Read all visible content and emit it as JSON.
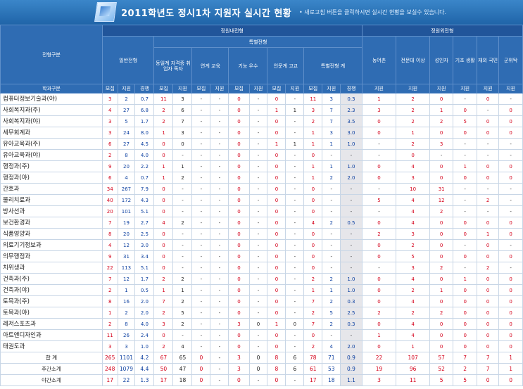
{
  "banner": {
    "title": "2011학년도 정시1차 지원자 실시간 현황",
    "note": "• 새로고침 버튼을 클릭하시면 실시간 현황을 보실수 있습니다."
  },
  "header": {
    "col_track": "전형구분",
    "group_in": "정원내전형",
    "group_out": "정원외전형",
    "general": "일반전형",
    "special": "특별전형",
    "sp1": "동일계 자격증 취업자 독자",
    "sp2": "연계 교육",
    "sp3": "기능 우수",
    "sp4": "인문계 고교",
    "sp_total": "특별전형 계",
    "o1": "농어촌",
    "o2": "전문대 이상",
    "o3": "성인자",
    "o4": "기초 생활",
    "o5": "재외 국민",
    "o6": "군위탁",
    "dept": "학과구분"
  },
  "sub_labels": [
    "모집",
    "지원",
    "경쟁",
    "모집",
    "지원",
    "모집",
    "지원",
    "모집",
    "지원",
    "모집",
    "지원",
    "모집",
    "지원",
    "경쟁",
    "지원",
    "지원",
    "지원",
    "지원",
    "지원",
    "지원"
  ],
  "rows": [
    [
      "컴퓨터정보기술과(야)",
      "3",
      "2",
      "0.7",
      "11",
      "3",
      "-",
      "-",
      "0",
      "-",
      "0",
      "-",
      "11",
      "3",
      "0.3",
      "1",
      "2",
      "0",
      "-",
      "0",
      "-"
    ],
    [
      "사회복지과(주)",
      "4",
      "27",
      "6.8",
      "2",
      "6",
      "-",
      "-",
      "0",
      "-",
      "1",
      "1",
      "3",
      "7",
      "2.3",
      "3",
      "2",
      "1",
      "0",
      "-",
      "0"
    ],
    [
      "사회복지과(야)",
      "3",
      "5",
      "1.7",
      "2",
      "7",
      "-",
      "-",
      "0",
      "-",
      "0",
      "-",
      "2",
      "7",
      "3.5",
      "0",
      "2",
      "2",
      "5",
      "0",
      "0"
    ],
    [
      "세무회계과",
      "3",
      "24",
      "8.0",
      "1",
      "3",
      "-",
      "-",
      "0",
      "-",
      "0",
      "-",
      "1",
      "3",
      "3.0",
      "0",
      "1",
      "0",
      "0",
      "0",
      "0"
    ],
    [
      "유아교육과(주)",
      "6",
      "27",
      "4.5",
      "0",
      "0",
      "-",
      "-",
      "0",
      "-",
      "1",
      "1",
      "1",
      "1",
      "1.0",
      "-",
      "2",
      "3",
      "-",
      "-",
      "-"
    ],
    [
      "유아교육과(야)",
      "2",
      "8",
      "4.0",
      "0",
      "-",
      "-",
      "-",
      "0",
      "-",
      "0",
      "-",
      "0",
      "-",
      "-",
      "-",
      "0",
      "-",
      "-",
      "-",
      "-"
    ],
    [
      "행정과(주)",
      "9",
      "20",
      "2.2",
      "1",
      "1",
      "-",
      "-",
      "0",
      "-",
      "0",
      "-",
      "1",
      "1",
      "1.0",
      "0",
      "4",
      "0",
      "1",
      "0",
      "0"
    ],
    [
      "행정과(야)",
      "6",
      "4",
      "0.7",
      "1",
      "2",
      "-",
      "-",
      "0",
      "-",
      "0",
      "-",
      "1",
      "2",
      "2.0",
      "0",
      "3",
      "0",
      "0",
      "0",
      "0"
    ],
    [
      "간호과",
      "34",
      "267",
      "7.9",
      "0",
      "-",
      "-",
      "-",
      "0",
      "-",
      "0",
      "-",
      "0",
      "-",
      "-",
      "-",
      "10",
      "31",
      "-",
      "-",
      "-"
    ],
    [
      "물리치료과",
      "40",
      "172",
      "4.3",
      "0",
      "-",
      "-",
      "-",
      "0",
      "-",
      "0",
      "-",
      "0",
      "-",
      "-",
      "5",
      "4",
      "12",
      "-",
      "2",
      "-"
    ],
    [
      "방사선과",
      "20",
      "101",
      "5.1",
      "0",
      "-",
      "-",
      "-",
      "0",
      "-",
      "0",
      "-",
      "0",
      "-",
      "-",
      "-",
      "4",
      "2",
      "-",
      "-",
      "-"
    ],
    [
      "보건환경과",
      "7",
      "19",
      "2.7",
      "4",
      "2",
      "-",
      "-",
      "0",
      "-",
      "0",
      "-",
      "4",
      "2",
      "0.5",
      "0",
      "4",
      "0",
      "0",
      "0",
      "0"
    ],
    [
      "식품영양과",
      "8",
      "20",
      "2.5",
      "0",
      "-",
      "-",
      "-",
      "0",
      "-",
      "0",
      "-",
      "0",
      "-",
      "-",
      "2",
      "3",
      "0",
      "0",
      "1",
      "0"
    ],
    [
      "의료기기정보과",
      "4",
      "12",
      "3.0",
      "0",
      "-",
      "-",
      "-",
      "0",
      "-",
      "0",
      "-",
      "0",
      "-",
      "-",
      "0",
      "2",
      "0",
      "-",
      "0",
      "-"
    ],
    [
      "의무행정과",
      "9",
      "31",
      "3.4",
      "0",
      "-",
      "-",
      "-",
      "0",
      "-",
      "0",
      "-",
      "0",
      "-",
      "-",
      "0",
      "5",
      "0",
      "0",
      "0",
      "0"
    ],
    [
      "치위생과",
      "22",
      "113",
      "5.1",
      "0",
      "-",
      "-",
      "-",
      "0",
      "-",
      "0",
      "-",
      "0",
      "-",
      "-",
      "-",
      "3",
      "2",
      "-",
      "2",
      "-"
    ],
    [
      "건축과(주)",
      "7",
      "12",
      "1.7",
      "2",
      "2",
      "-",
      "-",
      "0",
      "-",
      "0",
      "-",
      "2",
      "2",
      "1.0",
      "0",
      "4",
      "0",
      "1",
      "0",
      "0"
    ],
    [
      "건축과(야)",
      "2",
      "1",
      "0.5",
      "1",
      "1",
      "-",
      "-",
      "0",
      "-",
      "0",
      "-",
      "1",
      "1",
      "1.0",
      "0",
      "2",
      "1",
      "0",
      "0",
      "0"
    ],
    [
      "토목과(주)",
      "8",
      "16",
      "2.0",
      "7",
      "2",
      "-",
      "-",
      "0",
      "-",
      "0",
      "-",
      "7",
      "2",
      "0.3",
      "0",
      "4",
      "0",
      "0",
      "0",
      "0"
    ],
    [
      "토목과(야)",
      "1",
      "2",
      "2.0",
      "2",
      "5",
      "-",
      "-",
      "0",
      "-",
      "0",
      "-",
      "2",
      "5",
      "2.5",
      "2",
      "2",
      "2",
      "0",
      "0",
      "0"
    ],
    [
      "레저스포츠과",
      "2",
      "8",
      "4.0",
      "3",
      "2",
      "-",
      "-",
      "3",
      "0",
      "1",
      "0",
      "7",
      "2",
      "0.3",
      "0",
      "4",
      "0",
      "0",
      "0",
      "0"
    ],
    [
      "아트앤디자인과",
      "11",
      "26",
      "2.4",
      "0",
      "-",
      "-",
      "-",
      "0",
      "-",
      "0",
      "-",
      "0",
      "-",
      "-",
      "1",
      "4",
      "0",
      "0",
      "0",
      "0"
    ],
    [
      "태권도과",
      "3",
      "3",
      "1.0",
      "2",
      "4",
      "-",
      "-",
      "0",
      "-",
      "0",
      "-",
      "2",
      "4",
      "2.0",
      "0",
      "1",
      "0",
      "0",
      "0",
      "0"
    ]
  ],
  "totals": [
    [
      "합 계",
      "265",
      "1101",
      "4.2",
      "67",
      "65",
      "0",
      "-",
      "3",
      "0",
      "8",
      "6",
      "78",
      "71",
      "0.9",
      "22",
      "107",
      "57",
      "7",
      "7",
      "1"
    ],
    [
      "주간소계",
      "248",
      "1079",
      "4.4",
      "50",
      "47",
      "0",
      "-",
      "3",
      "0",
      "8",
      "6",
      "61",
      "53",
      "0.9",
      "19",
      "96",
      "52",
      "2",
      "7",
      "1"
    ],
    [
      "야간소계",
      "17",
      "22",
      "1.3",
      "17",
      "18",
      "0",
      "-",
      "0",
      "-",
      "0",
      "-",
      "17",
      "18",
      "1.1",
      "3",
      "11",
      "5",
      "5",
      "0",
      "0"
    ]
  ]
}
